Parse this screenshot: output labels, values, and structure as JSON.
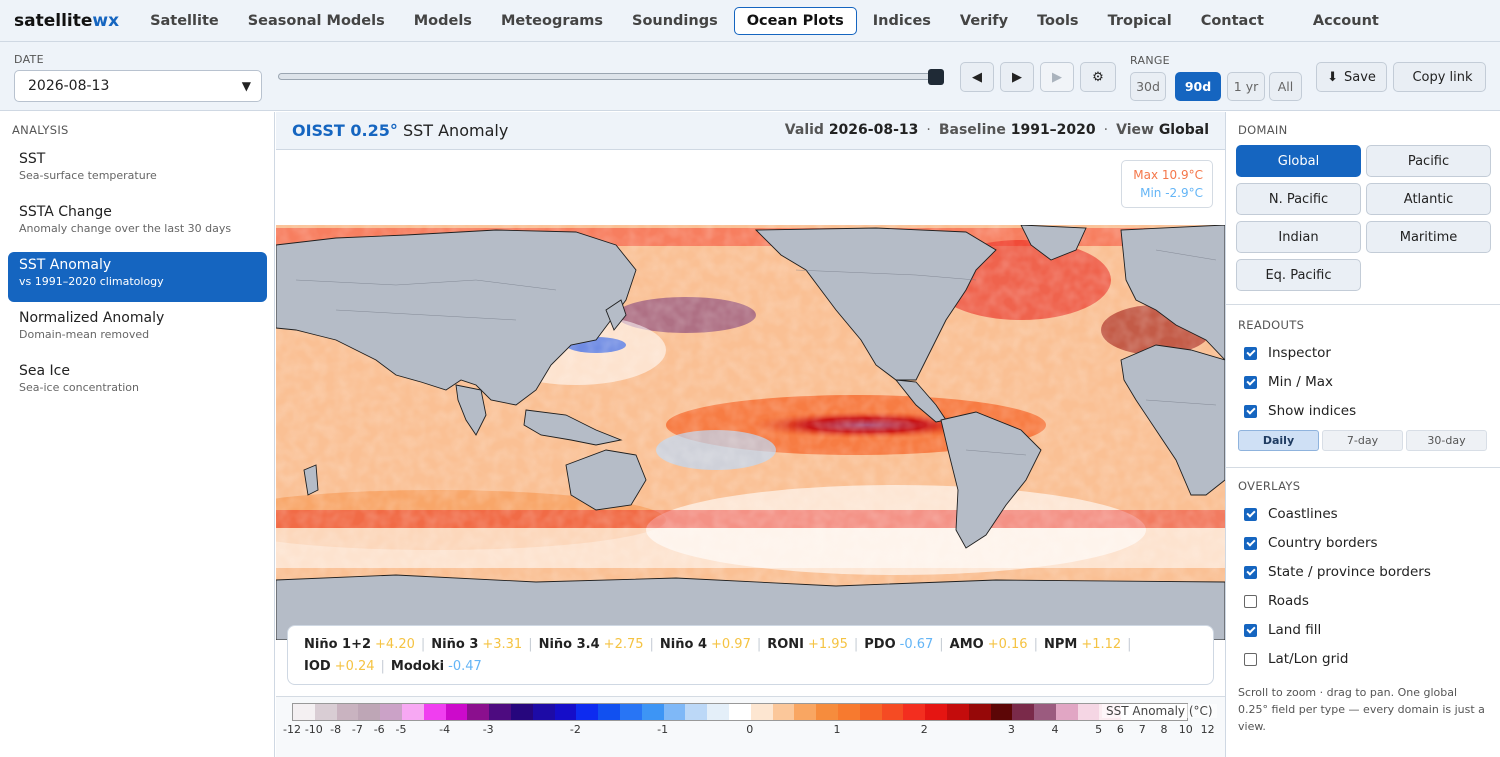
{
  "brand": {
    "main": "satellite",
    "accent": "wx"
  },
  "nav": {
    "items": [
      "Satellite",
      "Seasonal Models",
      "Models",
      "Meteograms",
      "Soundings",
      "Ocean Plots",
      "Indices",
      "Verify",
      "Tools",
      "Tropical",
      "Contact"
    ],
    "active": "Ocean Plots",
    "icon_glyph": "",
    "account": "Account"
  },
  "toolbar": {
    "date_label": "DATE",
    "date_value": "2026-08-13",
    "range_label": "RANGE",
    "range_options": [
      "30d",
      "90d",
      "1 yr",
      "All"
    ],
    "range_active": "90d",
    "prev_glyph": "◀",
    "next_glyph": "▶",
    "play_glyph": "▶",
    "settings_glyph": "⚙",
    "save_icon": "⬇",
    "save_label": "Save",
    "copy_icon": "",
    "copy_label": "Copy link",
    "slider_fraction": 1.0
  },
  "left": {
    "section": "ANALYSIS",
    "items": [
      {
        "title": "SST",
        "sub": "Sea-surface temperature"
      },
      {
        "title": "SSTA Change",
        "sub": "Anomaly change over the last 30 days"
      },
      {
        "title": "SST Anomaly",
        "sub": "vs 1991–2020 climatology"
      },
      {
        "title": "Normalized Anomaly",
        "sub": "Domain-mean removed"
      },
      {
        "title": "Sea Ice",
        "sub": "Sea-ice concentration"
      }
    ],
    "active_index": 2
  },
  "map": {
    "product": "OISST 0.25°",
    "field": "SST Anomaly",
    "valid_label": "Valid",
    "valid_value": "2026-08-13",
    "baseline_label": "Baseline",
    "baseline_value": "1991–2020",
    "view_label": "View",
    "view_value": "Global",
    "max_text": "Max 10.9°C",
    "min_text": "Min -2.9°C"
  },
  "indices": [
    {
      "name": "Niño 1+2",
      "value": "+4.20",
      "sign": "pos"
    },
    {
      "name": "Niño 3",
      "value": "+3.31",
      "sign": "pos"
    },
    {
      "name": "Niño 3.4",
      "value": "+2.75",
      "sign": "pos"
    },
    {
      "name": "Niño 4",
      "value": "+0.97",
      "sign": "pos"
    },
    {
      "name": "RONI",
      "value": "+1.95",
      "sign": "pos"
    },
    {
      "name": "PDO",
      "value": "-0.67",
      "sign": "neg"
    },
    {
      "name": "AMO",
      "value": "+0.16",
      "sign": "pos"
    },
    {
      "name": "NPM",
      "value": "+1.12",
      "sign": "pos"
    },
    {
      "name": "IOD",
      "value": "+0.24",
      "sign": "pos"
    },
    {
      "name": "Modoki",
      "value": "-0.47",
      "sign": "neg"
    }
  ],
  "legend": {
    "label": "SST Anomaly (°C)",
    "colors": [
      "#f4f0f2",
      "#d9cdd4",
      "#c9b3c0",
      "#bea6b6",
      "#cba2c7",
      "#f7a8f3",
      "#f03ef0",
      "#cc0acb",
      "#8b0f8e",
      "#4d0b80",
      "#26067d",
      "#1d0ba6",
      "#150dc9",
      "#0d2bf0",
      "#1150f0",
      "#2875f5",
      "#3d95f5",
      "#7fb8f7",
      "#bcd8f7",
      "#e4eff9",
      "#ffffff",
      "#fde6d1",
      "#fbc79a",
      "#f9a662",
      "#f68c3d",
      "#f77a2f",
      "#f66528",
      "#f54b23",
      "#f32e1f",
      "#e51512",
      "#c40c0c",
      "#960808",
      "#5c0606",
      "#7a2a4a",
      "#9b5b7f",
      "#e1a6c4",
      "#f5d6e4",
      "#fcecf1",
      "#ffffff",
      "#ffffff",
      "#ffffff"
    ],
    "ticks": [
      {
        "t": "-12",
        "i": 0
      },
      {
        "t": "-10",
        "i": 1
      },
      {
        "t": "-8",
        "i": 2
      },
      {
        "t": "-7",
        "i": 3
      },
      {
        "t": "-6",
        "i": 4
      },
      {
        "t": "-5",
        "i": 5
      },
      {
        "t": "-4",
        "i": 7
      },
      {
        "t": "-3",
        "i": 9
      },
      {
        "t": "-2",
        "i": 13
      },
      {
        "t": "-1",
        "i": 17
      },
      {
        "t": "0",
        "i": 21
      },
      {
        "t": "1",
        "i": 25
      },
      {
        "t": "2",
        "i": 29
      },
      {
        "t": "3",
        "i": 33
      },
      {
        "t": "4",
        "i": 35
      },
      {
        "t": "5",
        "i": 37
      },
      {
        "t": "6",
        "i": 38
      },
      {
        "t": "7",
        "i": 39
      },
      {
        "t": "8",
        "i": 40
      },
      {
        "t": "10",
        "i": 41
      },
      {
        "t": "12",
        "i": 42
      }
    ]
  },
  "right": {
    "domain_label": "DOMAIN",
    "domains": [
      "Global",
      "Pacific",
      "N. Pacific",
      "Atlantic",
      "Indian",
      "Maritime",
      "Eq. Pacific"
    ],
    "domain_active": "Global",
    "readouts_label": "READOUTS",
    "readouts": [
      {
        "label": "Inspector",
        "checked": true
      },
      {
        "label": "Min / Max",
        "checked": true
      },
      {
        "label": "Show indices",
        "checked": true
      }
    ],
    "period_options": [
      "Daily",
      "7-day",
      "30-day"
    ],
    "period_active": "Daily",
    "overlays_label": "OVERLAYS",
    "overlays": [
      {
        "label": "Coastlines",
        "checked": true
      },
      {
        "label": "Country borders",
        "checked": true
      },
      {
        "label": "State / province borders",
        "checked": true
      },
      {
        "label": "Roads",
        "checked": false
      },
      {
        "label": "Land fill",
        "checked": true
      },
      {
        "label": "Lat/Lon grid",
        "checked": false
      }
    ],
    "help_text": "Scroll to zoom · drag to pan. One global 0.25° field per type — every domain is just a view."
  }
}
